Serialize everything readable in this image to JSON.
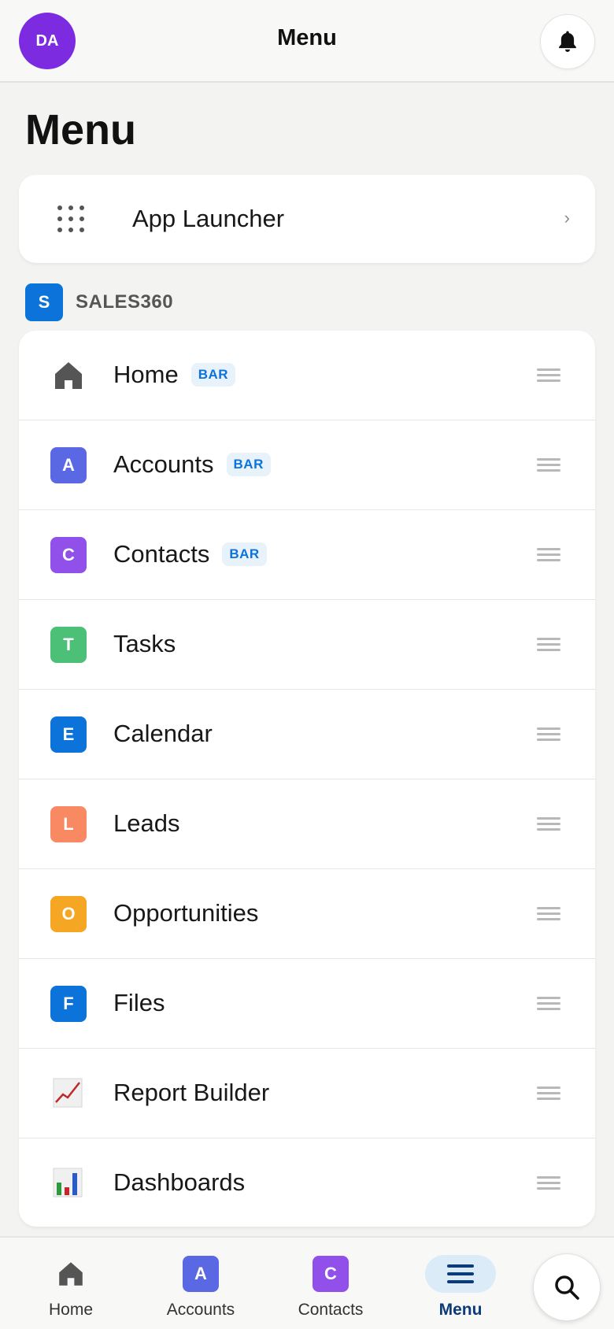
{
  "header": {
    "avatar_initials": "DA",
    "title": "Menu"
  },
  "page_title": "Menu",
  "launcher": {
    "label": "App Launcher"
  },
  "section": {
    "badge": "S",
    "name": "SALES360"
  },
  "nav_items": [
    {
      "label": "Home",
      "icon": "home-icon",
      "tag": "BAR"
    },
    {
      "label": "Accounts",
      "icon_letter": "A",
      "color": "#5b68e3",
      "tag": "BAR"
    },
    {
      "label": "Contacts",
      "icon_letter": "C",
      "color": "#9050e9",
      "tag": "BAR"
    },
    {
      "label": "Tasks",
      "icon_letter": "T",
      "color": "#4bc076"
    },
    {
      "label": "Calendar",
      "icon_letter": "E",
      "color": "#0b73d9"
    },
    {
      "label": "Leads",
      "icon_letter": "L",
      "color": "#f88962"
    },
    {
      "label": "Opportunities",
      "icon_letter": "O",
      "color": "#f5a623"
    },
    {
      "label": "Files",
      "icon_letter": "F",
      "color": "#0b73d9"
    },
    {
      "label": "Report Builder",
      "icon": "line-chart-icon"
    },
    {
      "label": "Dashboards",
      "icon": "bar-chart-icon"
    }
  ],
  "bottom_tabs": [
    {
      "label": "Home",
      "icon": "home-icon"
    },
    {
      "label": "Accounts",
      "icon_letter": "A",
      "color": "#5b68e3"
    },
    {
      "label": "Contacts",
      "icon_letter": "C",
      "color": "#9050e9"
    },
    {
      "label": "Menu",
      "icon": "hamburger-icon",
      "active": true
    }
  ]
}
